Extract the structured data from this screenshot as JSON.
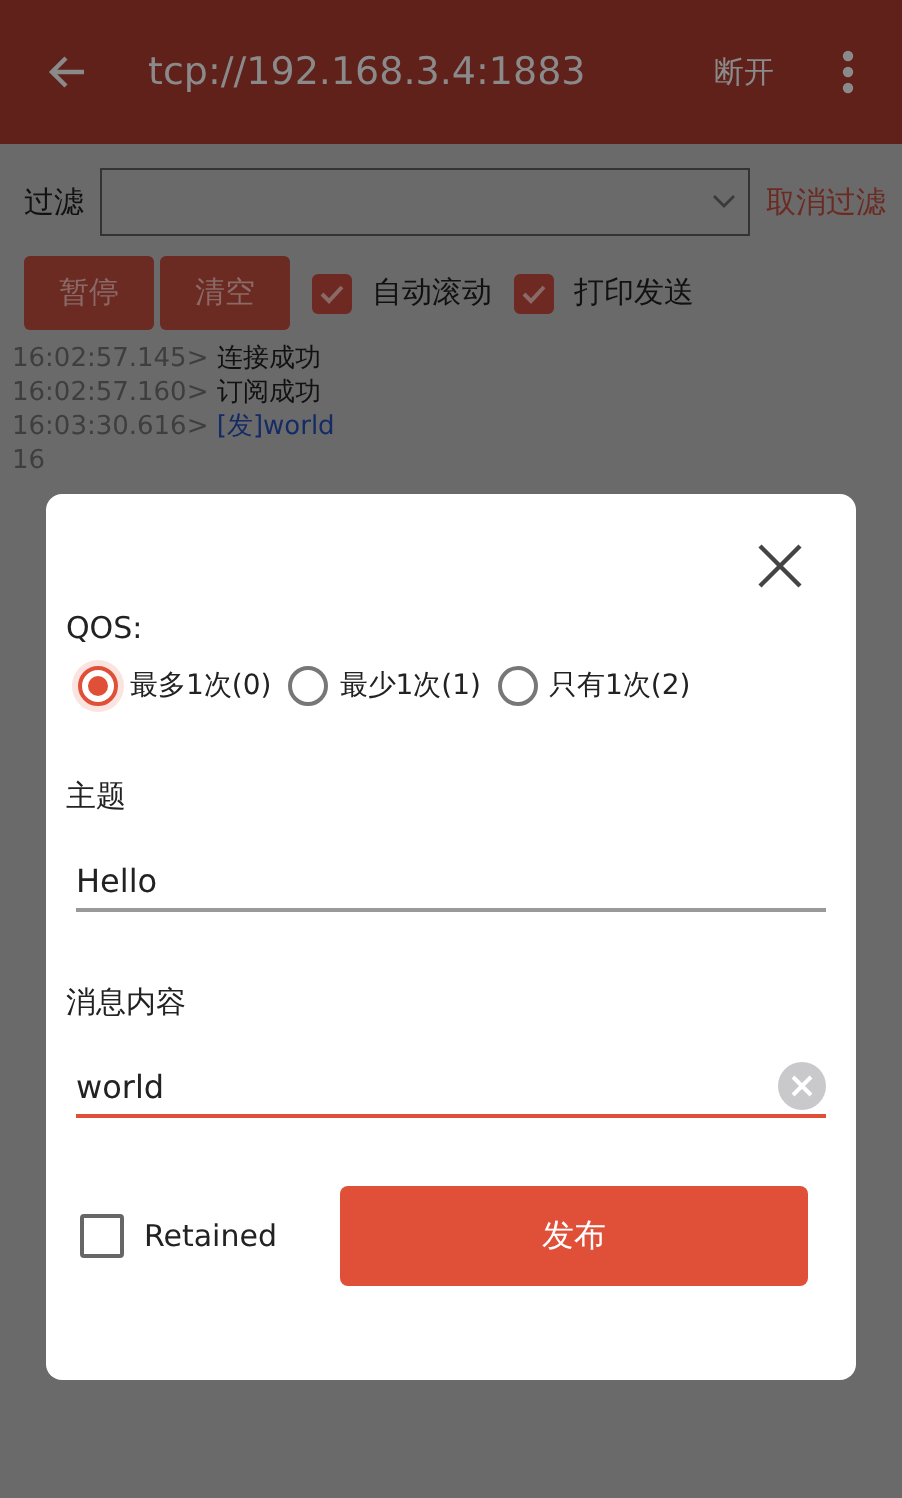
{
  "app_bar": {
    "title": "tcp://192.168.3.4:1883",
    "action": "断开"
  },
  "filter": {
    "label": "过滤",
    "cancel": "取消过滤"
  },
  "buttons": [
    "暂停",
    "清空"
  ],
  "checkboxes": [
    {
      "label": "自动滚动",
      "checked": true
    },
    {
      "label": "打印发送",
      "checked": true
    }
  ],
  "log": [
    {
      "time": "16:02:57.145>",
      "message": "连接成功",
      "kind": "received"
    },
    {
      "time": "16:02:57.160>",
      "message": "订阅成功",
      "kind": "received"
    },
    {
      "time": "16:03:30.616>",
      "message": "[发]world",
      "kind": "sent"
    },
    {
      "time": "16"
    }
  ],
  "dialog": {
    "qos_label": "QOS:",
    "qos_options": [
      {
        "label": "最多1次(0)",
        "selected": true
      },
      {
        "label": "最少1次(1)",
        "selected": false
      },
      {
        "label": "只有1次(2)",
        "selected": false
      }
    ],
    "topic": {
      "label": "主题",
      "value": "Hello",
      "focused": false
    },
    "message": {
      "label": "消息内容",
      "value": "world",
      "focused": true
    },
    "retained": {
      "label": "Retained",
      "checked": false
    },
    "publish": "发布"
  }
}
